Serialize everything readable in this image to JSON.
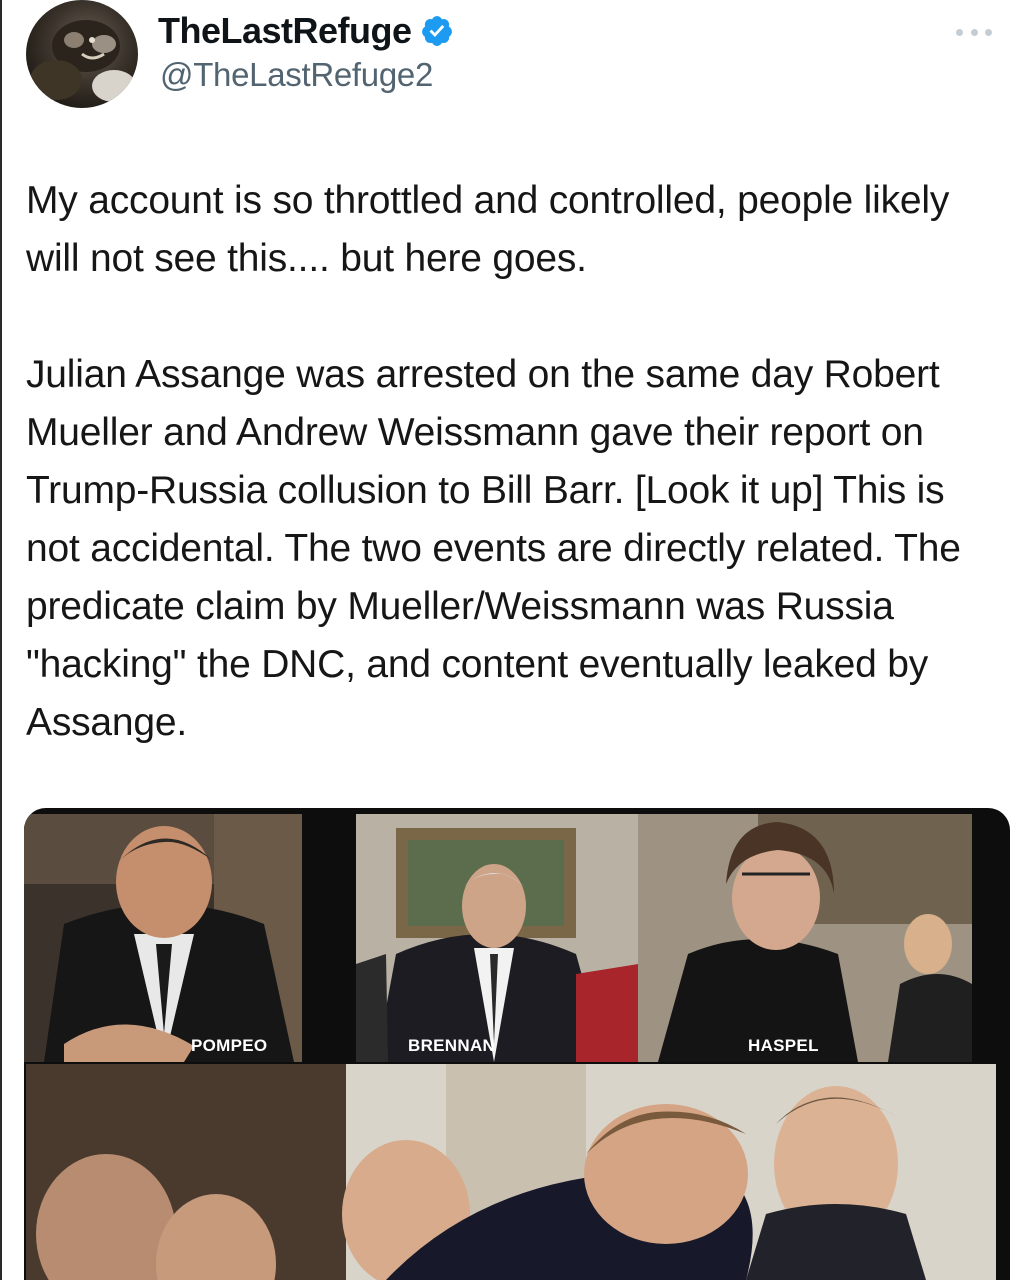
{
  "tweet": {
    "display_name": "TheLastRefuge",
    "handle": "@TheLastRefuge2",
    "verified_icon": "verified-badge-icon",
    "more_icon": "more-options-icon",
    "paragraphs": [
      "My account is so throttled and controlled, people likely will not see this.... but here goes.",
      "Julian Assange was arrested on the same day Robert Mueller and Andrew Weissmann gave their report on Trump-Russia collusion to Bill Barr. [Look it up]  This is not accidental. The two events are directly related.  The predicate claim by Mueller/Weissmann was Russia \"hacking\" the DNC, and content eventually leaked by Assange."
    ]
  },
  "media": {
    "captions": [
      "POMPEO",
      "BRENNAN",
      "HASPEL"
    ]
  },
  "colors": {
    "verified_blue": "#1d9bf0",
    "handle_gray": "#536471",
    "text": "#161616"
  }
}
